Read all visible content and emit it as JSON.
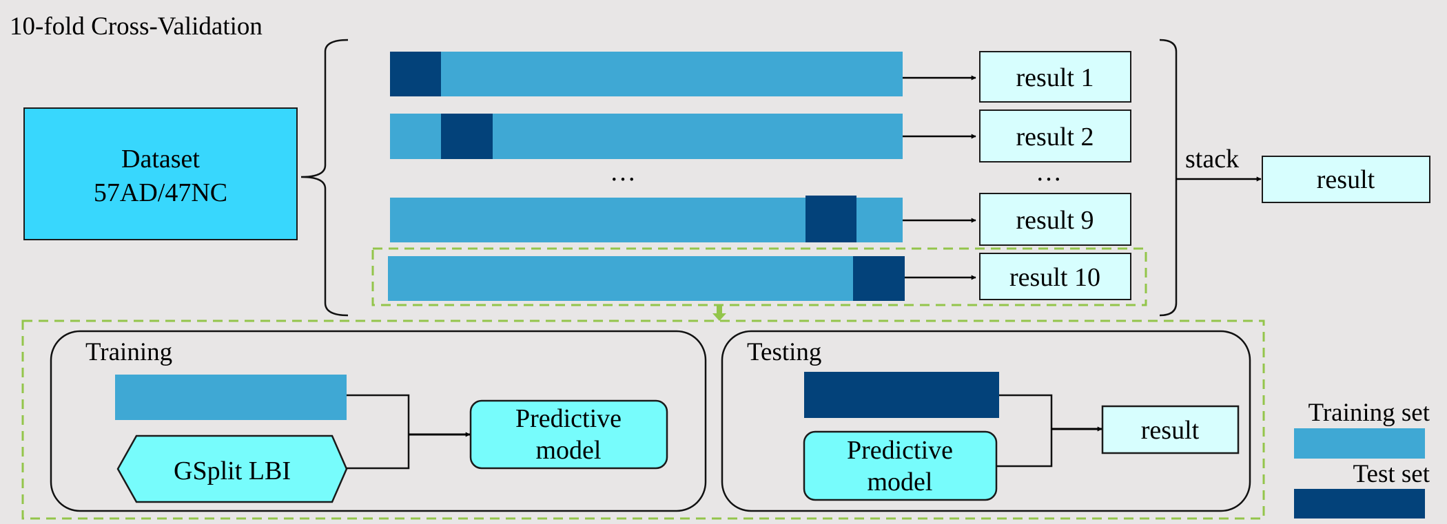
{
  "title": "10-fold Cross-Validation",
  "dataset": {
    "line1": "Dataset",
    "line2": "57AD/47NC"
  },
  "folds": [
    {
      "result_label": "result 1"
    },
    {
      "result_label": "result 2"
    },
    {
      "result_label": "result 9"
    },
    {
      "result_label": "result 10"
    }
  ],
  "ellipsis": "…",
  "stack_label": "stack",
  "final_result": "result",
  "training_panel": {
    "title": "Training",
    "algorithm": "GSplit LBI",
    "model_line1": "Predictive",
    "model_line2": "model"
  },
  "testing_panel": {
    "title": "Testing",
    "model_line1": "Predictive",
    "model_line2": "model",
    "result": "result"
  },
  "legend": {
    "training": "Training set",
    "test": "Test set"
  },
  "colors": {
    "background": "#e8e6e6",
    "training_set": "#3fa8d4",
    "test_set": "#03427a",
    "dataset": "#38d7fd",
    "result": "#d7fefe",
    "model": "#77fcfc",
    "highlight": "#93c54b"
  }
}
